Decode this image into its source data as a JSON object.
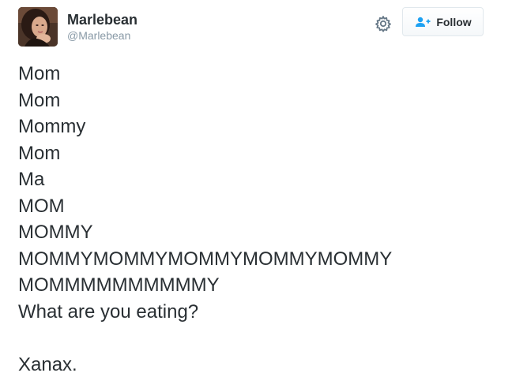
{
  "user": {
    "display_name": "Marlebean",
    "handle": "@Marlebean"
  },
  "actions": {
    "follow_label": "Follow",
    "settings_icon": "gear-icon",
    "follow_icon": "person-plus-icon"
  },
  "colors": {
    "text": "#292f33",
    "handle": "#8899a6",
    "follow_icon": "#1da1f2",
    "border": "#e1e8ed"
  },
  "tweet": {
    "lines": [
      "Mom",
      "Mom",
      "Mommy",
      "Mom",
      "Ma",
      "MOM",
      "MOMMY",
      "MOMMYMOMMYMOMMYMOMMYMOMMY",
      "MOMMMMMMMMMMY",
      "What are you eating?",
      "",
      "Xanax."
    ]
  }
}
